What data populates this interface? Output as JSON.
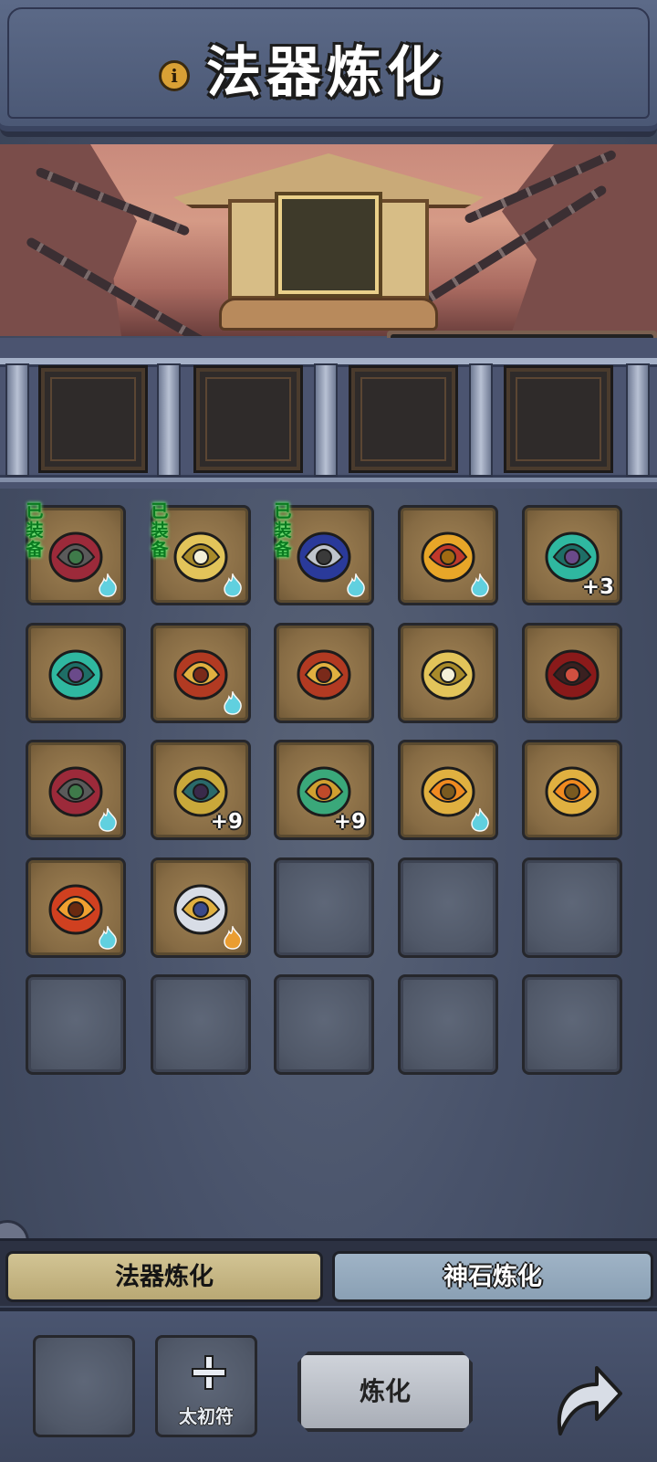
{
  "header": {
    "title": "法器炼化",
    "info_icon": "info-icon"
  },
  "shrine": {
    "progress": 0.0
  },
  "inventory": {
    "items": [
      {
        "icon": "horned-armor-icon",
        "equipped_label": "已装备",
        "flame": "blue"
      },
      {
        "icon": "golden-boots-icon",
        "equipped_label": "已装备",
        "flame": "blue"
      },
      {
        "icon": "sapphire-ring-icon",
        "equipped_label": "已装备",
        "flame": "blue"
      },
      {
        "icon": "ruby-ring-icon",
        "flame": "blue"
      },
      {
        "icon": "jade-necklace-icon",
        "plus": "+3"
      },
      {
        "icon": "jade-necklace-icon"
      },
      {
        "icon": "winged-boots-icon",
        "flame": "blue"
      },
      {
        "icon": "winged-boots-icon"
      },
      {
        "icon": "golden-boots-icon"
      },
      {
        "icon": "crimson-armor-icon"
      },
      {
        "icon": "horned-armor-icon",
        "flame": "blue"
      },
      {
        "icon": "dragon-helmet-icon",
        "plus": "+9"
      },
      {
        "icon": "jade-bracers-icon",
        "plus": "+9"
      },
      {
        "icon": "golden-mace-icon",
        "flame": "blue"
      },
      {
        "icon": "golden-mace-icon"
      },
      {
        "icon": "flame-spear-icon",
        "flame": "blue"
      },
      {
        "icon": "golden-sword-icon",
        "flame": "orange"
      }
    ],
    "total_slots": 25
  },
  "tabs": {
    "artifact": "法器炼化",
    "godstone": "神石炼化"
  },
  "bottom": {
    "talisman_label": "太初符",
    "refine_label": "炼化"
  },
  "colors": {
    "equipped_green": "#0a7a20",
    "blue_flame": "#5fd6e8",
    "orange_flame": "#f0a030",
    "tab_active": "#c9bb88",
    "tab_inactive": "#95aabd"
  }
}
